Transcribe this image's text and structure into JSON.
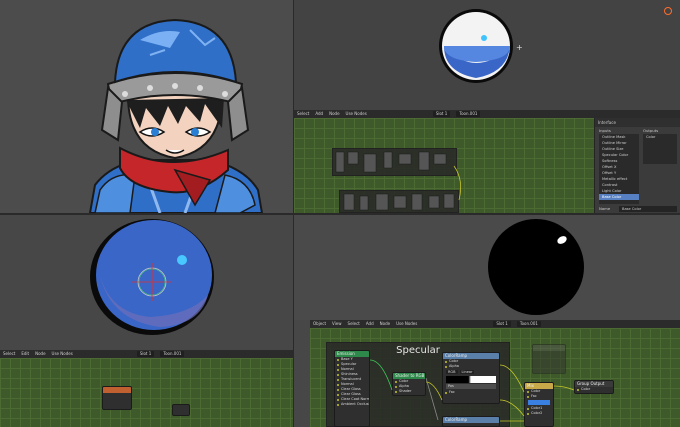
{
  "colors": {
    "bg": "#474747",
    "node_grid": "#3f5a2a",
    "header": "#2b2b2b",
    "accent": "#5680c2",
    "helmet": "#2f6fc7",
    "scarf": "#c4262a",
    "sphere_blue": "#3a66c8",
    "socket_yellow": "#c7c729"
  },
  "top_right": {
    "sphere": "glossy-sphere",
    "header": {
      "menus": [
        "Select",
        "Add",
        "Node"
      ],
      "use_nodes": "Use Nodes",
      "slot": "Slot 1",
      "material": "Toon.001"
    },
    "panel": {
      "title": "Interface",
      "inputs_label": "Inputs",
      "outputs_label": "Outputs",
      "inputs": [
        "Outline Mask",
        "Outline Mirror",
        "Outline Size",
        "Specular Color",
        "Softness",
        "Offset X",
        "Offset Y",
        "Metallic effect",
        "Contrast",
        "Light Color",
        "Base Color"
      ],
      "outputs": [
        "Color"
      ],
      "name_label": "Name",
      "name_value": "Base Color"
    }
  },
  "bottom_left": {
    "header": {
      "menus": [
        "Select",
        "Edit",
        "Node"
      ],
      "use_nodes": "Use Nodes",
      "slot": "Slot 1",
      "material": "Toon.001"
    }
  },
  "bottom_right": {
    "header": {
      "menus": [
        "Object",
        "View",
        "Select",
        "Add",
        "Node"
      ],
      "use_nodes": "Use Nodes",
      "slot": "Slot 1",
      "material": "Toon.001"
    },
    "frame_title": "Specular",
    "emission_node": {
      "title": "Emission",
      "rows": [
        "Base Y",
        "Specular",
        "Normal",
        "Shininess",
        "Translucent",
        "Normal",
        "Clear Gloss",
        "Clear Gloss",
        "Clear Coat Normal",
        "Ambient Occlusion"
      ]
    },
    "shader_to_rgb": {
      "title": "Shader to RGB",
      "rows": [
        "Color",
        "Alpha",
        "Shader"
      ]
    },
    "color_ramp": {
      "title": "ColorRamp",
      "rows": [
        "Color",
        "Alpha",
        "Fac"
      ],
      "mode": "RGB",
      "interp": "Linear",
      "pos_label": "Pos"
    },
    "color_ramp2": {
      "title": "ColorRamp"
    },
    "mix_node": {
      "title": "Mix",
      "rows": [
        "Color",
        "Fac",
        "Color1",
        "Color2"
      ]
    },
    "group_output": {
      "title": "Group Output",
      "rows": [
        "Color"
      ]
    }
  }
}
